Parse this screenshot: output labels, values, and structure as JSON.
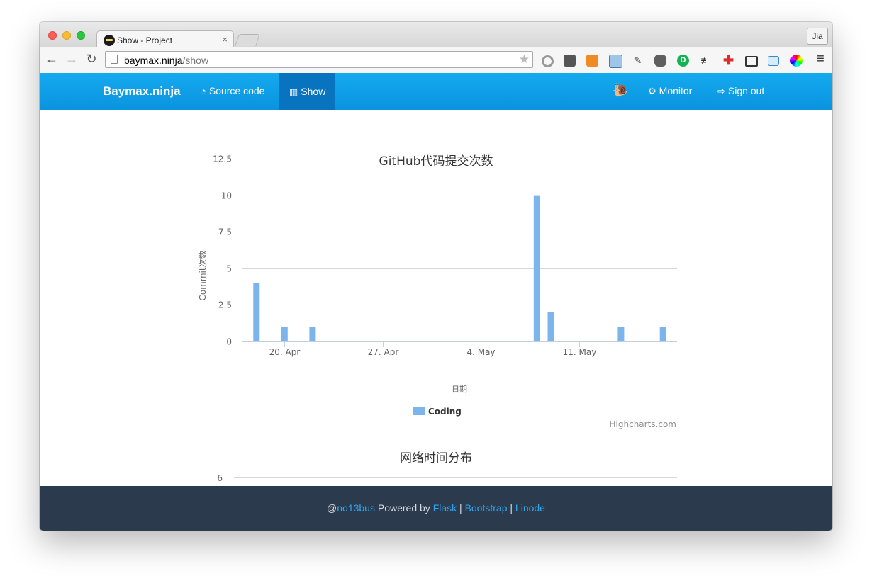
{
  "browser": {
    "tab_title": "Show - Project",
    "tab_close": "×",
    "profile": "Jia",
    "url_host": "baymax.ninja",
    "url_path": "/show",
    "back": "←",
    "forward": "→",
    "reload": "↻",
    "star": "★",
    "menu": "≡",
    "extension_icons": [
      "record-icon",
      "pocket-icon",
      "translate-icon",
      "bookmark-star-icon",
      "tool-icon",
      "evernote-icon",
      "d-icon",
      "proxy-icon",
      "plus-icon",
      "image-icon",
      "folder-icon",
      "color-wheel-icon"
    ]
  },
  "navbar": {
    "brand": "Baymax.ninja",
    "source_code": "Source code",
    "show": "Show",
    "monitor": "Monitor",
    "sign_out": "Sign out"
  },
  "chart1": {
    "title": "GitHub代码提交次数",
    "ylabel": "Commit次数",
    "xlabel": "日期",
    "legend": "Coding",
    "credits": "Highcharts.com"
  },
  "chart2": {
    "title": "网络时间分布",
    "first_ytick": "6"
  },
  "footer": {
    "at": "@",
    "user": "no13bus",
    "powered": " Powered by ",
    "flask": "Flask",
    "sep": " | ",
    "bootstrap": "Bootstrap",
    "linode": "Linode"
  },
  "colors": {
    "navbar": "#0a93de",
    "navbar_active": "#0874bf",
    "bar": "#7cb5ec",
    "footer": "#2b3a4c",
    "link": "#2fa7f2"
  },
  "chart_data": {
    "type": "bar",
    "title": "GitHub代码提交次数",
    "xlabel": "日期",
    "ylabel": "Commit次数",
    "ylim": [
      0,
      12.5
    ],
    "y_ticks": [
      "0",
      "2.5",
      "5",
      "7.5",
      "10",
      "12.5"
    ],
    "x_ticks": [
      "20. Apr",
      "27. Apr",
      "4. May",
      "11. May"
    ],
    "grid": true,
    "legend": "bottom",
    "series": [
      {
        "name": "Coding",
        "x": [
          "2015-04-18",
          "2015-04-20",
          "2015-04-22",
          "2015-05-08",
          "2015-05-09",
          "2015-05-14",
          "2015-05-17"
        ],
        "values": [
          4,
          1,
          1,
          10,
          2,
          1,
          1
        ]
      }
    ]
  }
}
